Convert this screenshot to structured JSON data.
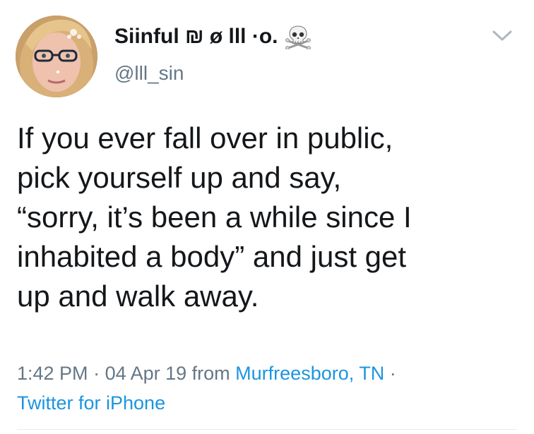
{
  "user": {
    "display_name": "Siinful ₪ ø lll ·o.",
    "handle": "@lll_sin"
  },
  "icons": {
    "skull": "skull-crossbones-icon",
    "chevron": "chevron-down-icon"
  },
  "tweet": {
    "lines": [
      "If you ever fall over in public,",
      "pick yourself up and say,",
      "“sorry, it’s been a while since I",
      "inhabited a body” and just get",
      "up and walk away."
    ]
  },
  "meta": {
    "time": "1:42 PM",
    "sep1": " · ",
    "date": "04 Apr 19",
    "from_word": " from ",
    "location": "Murfreesboro, TN",
    "sep2": " ·",
    "client": "Twitter for iPhone"
  },
  "colors": {
    "link": "#1b95e0",
    "secondary": "#657786",
    "text": "#14171a"
  }
}
